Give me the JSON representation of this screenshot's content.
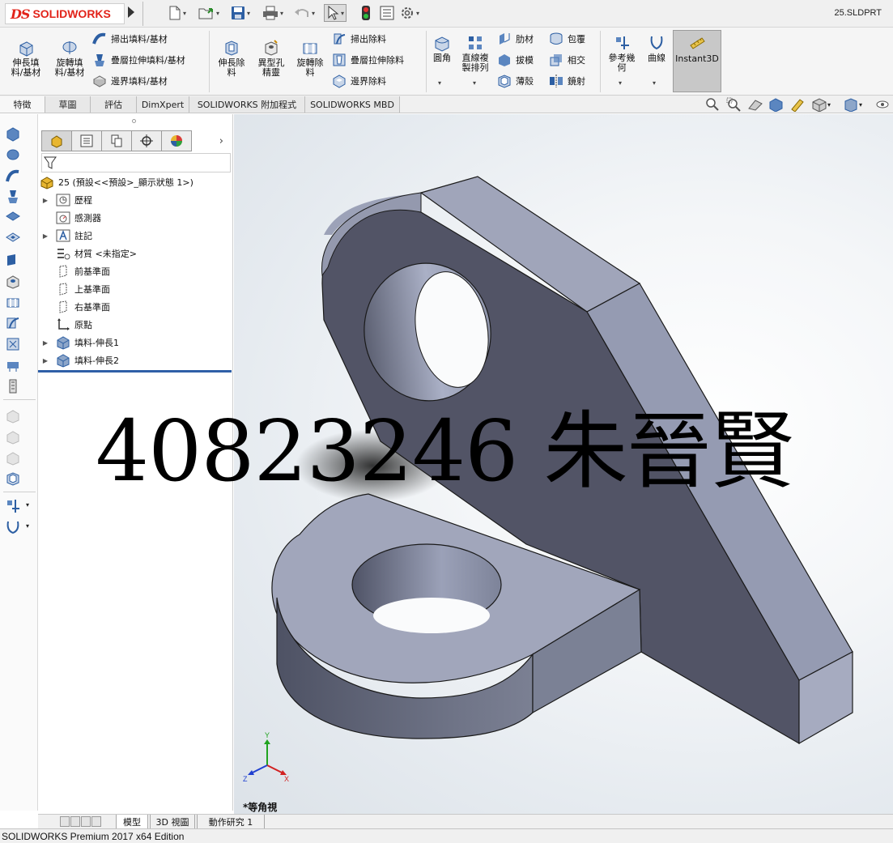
{
  "app": {
    "logo_ds": "DS",
    "logo_text": "SOLIDWORKS",
    "doc_title": "25.SLDPRT"
  },
  "quick_access": [
    {
      "name": "new-document-icon"
    },
    {
      "name": "open-folder-icon"
    },
    {
      "name": "save-icon"
    },
    {
      "name": "print-icon"
    },
    {
      "name": "undo-icon"
    },
    {
      "name": "select-arrow-icon"
    },
    {
      "name": "rebuild-traffic-light-icon"
    },
    {
      "name": "file-properties-icon"
    },
    {
      "name": "options-gear-icon"
    }
  ],
  "ribbon": {
    "extruded_boss": "伸長填\n料/基材",
    "revolved_boss": "旋轉填\n料/基材",
    "swept_boss": "掃出填料/基材",
    "lofted_boss": "疊層拉伸填料/基材",
    "boundary_boss": "邊界填料/基材",
    "extruded_cut": "伸長除\n料",
    "hole_wizard": "異型孔\n精靈",
    "revolved_cut": "旋轉除\n料",
    "swept_cut": "掃出除料",
    "lofted_cut": "疊層拉伸除料",
    "boundary_cut": "邊界除料",
    "fillet": "圓角",
    "linear_pattern": "直線複\n製排列",
    "rib": "肋材",
    "wrap": "包覆",
    "draft": "拔模",
    "intersect": "相交",
    "shell": "薄殼",
    "mirror": "鏡射",
    "ref_geometry": "參考幾\n何",
    "curves": "曲線",
    "instant3d": "Instant3D"
  },
  "tabs": [
    "特徵",
    "草圖",
    "評估",
    "DimXpert",
    "SOLIDWORKS 附加程式",
    "SOLIDWORKS MBD"
  ],
  "active_tab": "特徵",
  "feature_tree": {
    "root": "25 (預設<<預設>_顯示狀態 1>)",
    "items": [
      {
        "label": "歷程",
        "icon": "history-icon",
        "expandable": true
      },
      {
        "label": "感測器",
        "icon": "sensors-icon",
        "expandable": false
      },
      {
        "label": "註記",
        "icon": "annotations-icon",
        "expandable": true
      },
      {
        "label": "材質 <未指定>",
        "icon": "material-icon",
        "expandable": false
      },
      {
        "label": "前基準面",
        "icon": "plane-icon",
        "expandable": false
      },
      {
        "label": "上基準面",
        "icon": "plane-icon",
        "expandable": false
      },
      {
        "label": "右基準面",
        "icon": "plane-icon",
        "expandable": false
      },
      {
        "label": "原點",
        "icon": "origin-icon",
        "expandable": false
      },
      {
        "label": "填料-伸長1",
        "icon": "extrude-feature-icon",
        "expandable": true
      },
      {
        "label": "填料-伸長2",
        "icon": "extrude-feature-icon",
        "expandable": true
      }
    ]
  },
  "viewport": {
    "view_name": "*等角視",
    "triad": {
      "x": "X",
      "y": "Y",
      "z": "Z"
    }
  },
  "watermark": "40823246 朱晉賢",
  "bottom_tabs": [
    "模型",
    "3D 視圖",
    "動作研究 1"
  ],
  "active_bottom_tab": "模型",
  "status": "SOLIDWORKS Premium 2017 x64 Edition",
  "colors": {
    "accent_red": "#e2231a",
    "part_shade": "#9aa0b8",
    "rollback_bar": "#2f5fa7"
  }
}
